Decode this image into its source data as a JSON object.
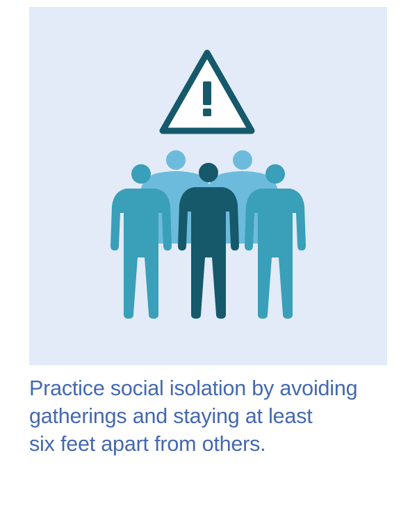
{
  "caption": {
    "text": "Practice social isolation by avoiding\ngatherings and staying at least\nsix feet apart from others."
  },
  "colors": {
    "panel_background": "#e2ebf7",
    "caption_text": "#4468b0",
    "warning_stroke": "#15596b",
    "warning_fill": "#ffffff",
    "back_people": "#6dbbdc",
    "side_people": "#3a9fb8",
    "center_person": "#15596b"
  },
  "icons": {
    "warning": "warning-triangle-icon",
    "group": "people-group-icon"
  }
}
